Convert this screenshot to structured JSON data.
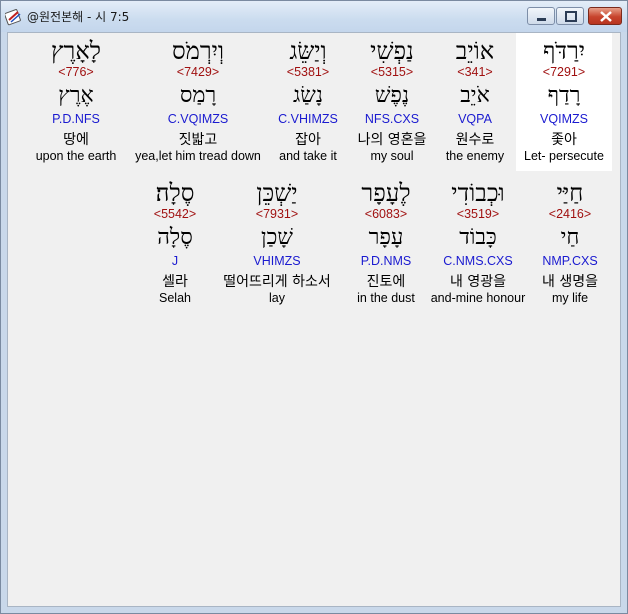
{
  "window": {
    "title": "@원전본해 - 시 7:5"
  },
  "rows": [
    {
      "words": [
        {
          "hebrew": "לָאָרֶץ",
          "strong": "<776>",
          "root": "אֶרֶץ",
          "parse": "P.D.NFS",
          "korean": "땅에",
          "english": "upon the earth"
        },
        {
          "hebrew": "וְיִרְמֹס",
          "strong": "<7429>",
          "root": "רָמַס",
          "parse": "C.VQIMZS",
          "korean": "짓밟고",
          "english": "yea,let him tread down"
        },
        {
          "hebrew": "וְיַשֵּׂג",
          "strong": "<5381>",
          "root": "נָשַׂג",
          "parse": "C.VHIMZS",
          "korean": "잡아",
          "english": "and take it"
        },
        {
          "hebrew": "נַפְשִׁי",
          "strong": "<5315>",
          "root": "נֶפֶשׁ",
          "parse": "NFS.CXS",
          "korean": "나의 영혼을",
          "english": "my soul"
        },
        {
          "hebrew": "אוֹיֵב",
          "strong": "<341>",
          "root": "אֹיֵב",
          "parse": "VQPA",
          "korean": "원수로",
          "english": "the enemy"
        },
        {
          "hebrew": "יִרַדֹּף",
          "strong": "<7291>",
          "root": "רָדַף",
          "parse": "VQIMZS",
          "korean": "좇아",
          "english": "Let- persecute"
        }
      ]
    },
    {
      "words": [
        {
          "hebrew": "סֶלָה׃",
          "strong": "<5542>",
          "root": "סֶלָה",
          "parse": "J",
          "korean": "셀라",
          "english": "Selah"
        },
        {
          "hebrew": "יַשְׁכֵּן",
          "strong": "<7931>",
          "root": "שָׁכַן",
          "parse": "VHIMZS",
          "korean": "떨어뜨리게 하소서",
          "english": "lay"
        },
        {
          "hebrew": "לֶעָפָר",
          "strong": "<6083>",
          "root": "עָפָר",
          "parse": "P.D.NMS",
          "korean": "진토에",
          "english": "in the dust"
        },
        {
          "hebrew": "וּכְבוֹדִי",
          "strong": "<3519>",
          "root": "כָּבוֹד",
          "parse": "C.NMS.CXS",
          "korean": "내 영광을",
          "english": "and-mine honour"
        },
        {
          "hebrew": "חַיַּי",
          "strong": "<2416>",
          "root": "חַי",
          "parse": "NMP.CXS",
          "korean": "내 생명을",
          "english": "my life"
        }
      ]
    }
  ]
}
